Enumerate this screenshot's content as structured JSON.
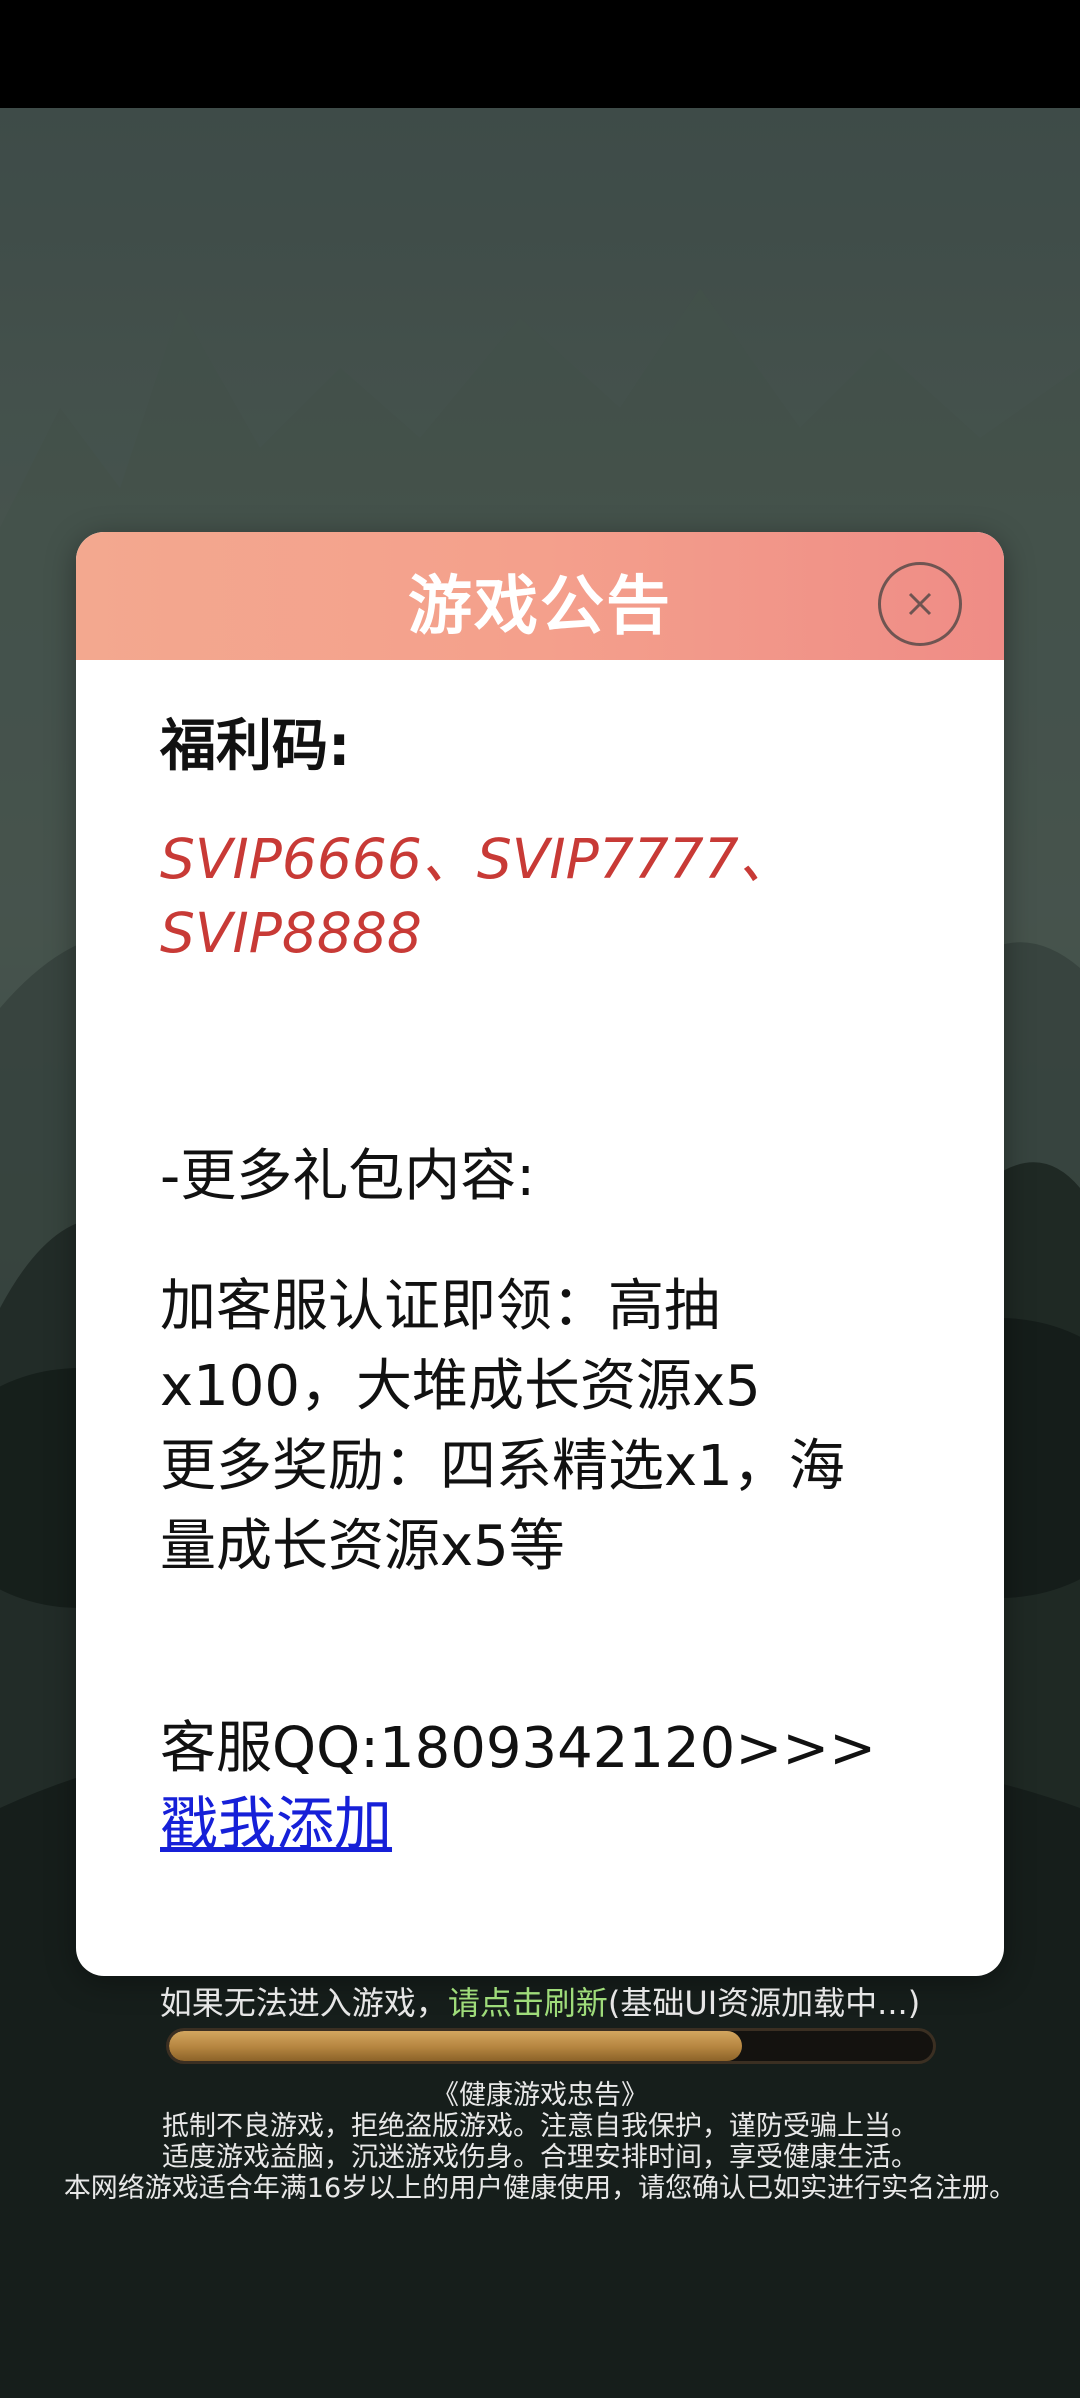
{
  "modal": {
    "title": "游戏公告",
    "code_heading": "福利码:",
    "codes_line1": "SVIP6666、SVIP7777、",
    "codes_line2": "SVIP8888",
    "more_heading": " -更多礼包内容:",
    "reward_lines": [
      "加客服认证即领：高抽",
      "x100，大堆成长资源x5",
      "更多奖励：四系精选x1，海",
      "量成长资源x5等"
    ],
    "qq_text": "客服QQ:1809342120>>>",
    "add_link": "戳我添加"
  },
  "loading": {
    "prefix": "如果无法进入游戏，",
    "refresh_link": "请点击刷新",
    "suffix": "(基础UI资源加载中...)",
    "progress_fraction": 0.75
  },
  "advisory": {
    "title": "《健康游戏忠告》",
    "line1": "抵制不良游戏，拒绝盗版游戏。注意自我保护，谨防受骗上当。",
    "line2": "适度游戏益脑，沉迷游戏伤身。合理安排时间，享受健康生活。",
    "line3": "本网络游戏适合年满16岁以上的用户健康使用，请您确认已如实进行实名注册。"
  },
  "colors": {
    "header": "#f3a88f",
    "code_red": "#c83a36",
    "link_blue": "#1620d8",
    "refresh_green": "#9fdc7a"
  },
  "icons": {
    "close": "close-icon"
  }
}
